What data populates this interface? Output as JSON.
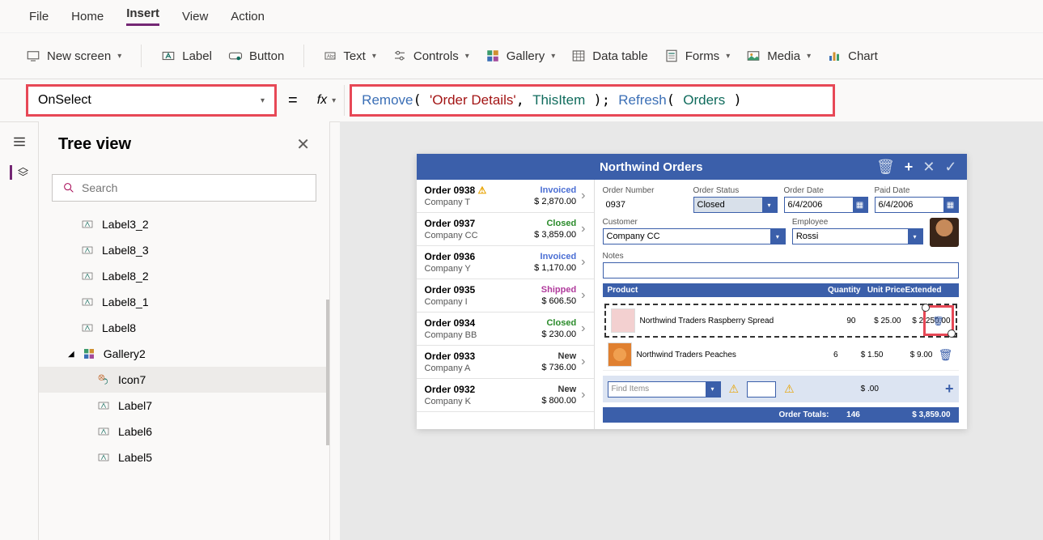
{
  "menu": {
    "file": "File",
    "home": "Home",
    "insert": "Insert",
    "view": "View",
    "action": "Action"
  },
  "toolbar": {
    "newscreen": "New screen",
    "label": "Label",
    "button": "Button",
    "text": "Text",
    "controls": "Controls",
    "gallery": "Gallery",
    "datatable": "Data table",
    "forms": "Forms",
    "media": "Media",
    "chart": "Chart"
  },
  "property": "OnSelect",
  "formula": {
    "remove": "Remove",
    "odetails": "'Order Details'",
    "thisitem": "ThisItem",
    "refresh": "Refresh",
    "orders": "Orders"
  },
  "tree": {
    "title": "Tree view",
    "search_ph": "Search",
    "items": [
      "Label3_2",
      "Label8_3",
      "Label8_2",
      "Label8_1",
      "Label8"
    ],
    "gallery": "Gallery2",
    "icon": "Icon7",
    "inner": [
      "Label7",
      "Label6",
      "Label5"
    ]
  },
  "app": {
    "title": "Northwind Orders",
    "orders": [
      {
        "num": "Order 0938",
        "warn": true,
        "status": "Invoiced",
        "cls": "invoiced",
        "company": "Company T",
        "amt": "$ 2,870.00"
      },
      {
        "num": "Order 0937",
        "status": "Closed",
        "cls": "closed",
        "company": "Company CC",
        "amt": "$ 3,859.00"
      },
      {
        "num": "Order 0936",
        "status": "Invoiced",
        "cls": "invoiced",
        "company": "Company Y",
        "amt": "$ 1,170.00"
      },
      {
        "num": "Order 0935",
        "status": "Shipped",
        "cls": "shipped",
        "company": "Company I",
        "amt": "$ 606.50"
      },
      {
        "num": "Order 0934",
        "status": "Closed",
        "cls": "closed",
        "company": "Company BB",
        "amt": "$ 230.00"
      },
      {
        "num": "Order 0933",
        "status": "New",
        "cls": "new",
        "company": "Company A",
        "amt": "$ 736.00"
      },
      {
        "num": "Order 0932",
        "status": "New",
        "cls": "new",
        "company": "Company K",
        "amt": "$ 800.00"
      }
    ],
    "fields": {
      "ordnum_l": "Order Number",
      "ordnum": "0937",
      "status_l": "Order Status",
      "status": "Closed",
      "orddate_l": "Order Date",
      "orddate": "6/4/2006",
      "paiddate_l": "Paid Date",
      "paiddate": "6/4/2006",
      "cust_l": "Customer",
      "cust": "Company CC",
      "emp_l": "Employee",
      "emp": "Rossi",
      "notes_l": "Notes"
    },
    "headers": {
      "product": "Product",
      "qty": "Quantity",
      "price": "Unit Price",
      "ext": "Extended"
    },
    "lines": [
      {
        "name": "Northwind Traders Raspberry Spread",
        "qty": "90",
        "price": "$ 25.00",
        "ext": "$ 2,250.00",
        "sel": true,
        "thumb": ""
      },
      {
        "name": "Northwind Traders Peaches",
        "qty": "6",
        "price": "$ 1.50",
        "ext": "$ 9.00",
        "thumb": "peach"
      }
    ],
    "find_ph": "Find Items",
    "add_ext": "$ .00",
    "totals": {
      "label": "Order Totals:",
      "qty": "146",
      "amt": "$ 3,859.00"
    }
  }
}
